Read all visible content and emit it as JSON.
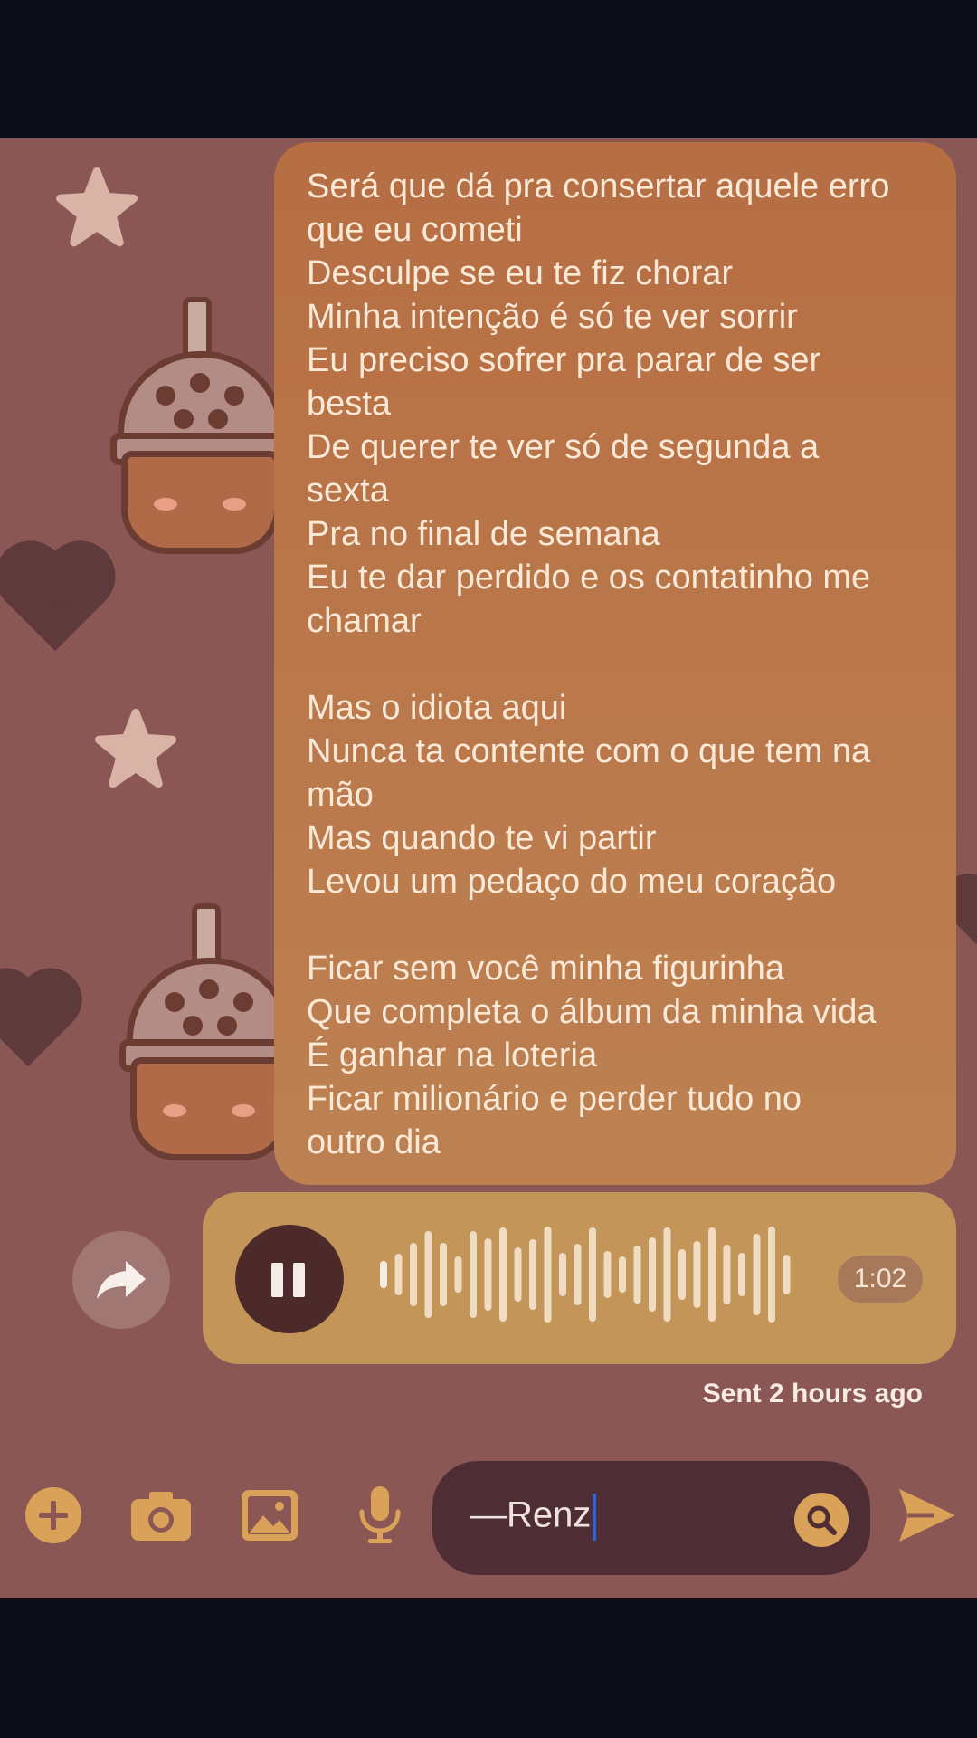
{
  "message": {
    "lyrics": [
      "Será que dá pra consertar aquele erro\nque eu cometi\nDesculpe se eu te fiz chorar\nMinha intenção é só te ver sorrir\nEu preciso sofrer pra parar de ser\nbesta\nDe querer te ver só de segunda a\nsexta\nPra no final de semana\nEu te dar perdido e os contatinho me\nchamar",
      "Mas o idiota aqui\nNunca ta contente com o que tem na\nmão\nMas quando te vi partir\nLevou um pedaço do meu coração",
      "Ficar sem você minha figurinha\nQue completa o álbum da minha vida\nÉ ganhar na loteria\nFicar milionário e perder tudo no\noutro dia"
    ]
  },
  "audio": {
    "duration": "1:02",
    "state": "playing"
  },
  "status": {
    "sent": "Sent 2 hours ago"
  },
  "composer": {
    "text": "—Renz"
  },
  "icons": {
    "forward": "forward-arrow-icon",
    "pause": "pause-icon",
    "add": "plus-icon",
    "camera": "camera-icon",
    "gallery": "image-icon",
    "mic": "microphone-icon",
    "search": "search-icon",
    "send": "send-icon"
  },
  "colors": {
    "wallpaper": "#8a5755",
    "bubble": "#b66e43",
    "audio_bubble": "#c49558",
    "accent": "#d9a258",
    "input_bg": "#4f2d35"
  }
}
